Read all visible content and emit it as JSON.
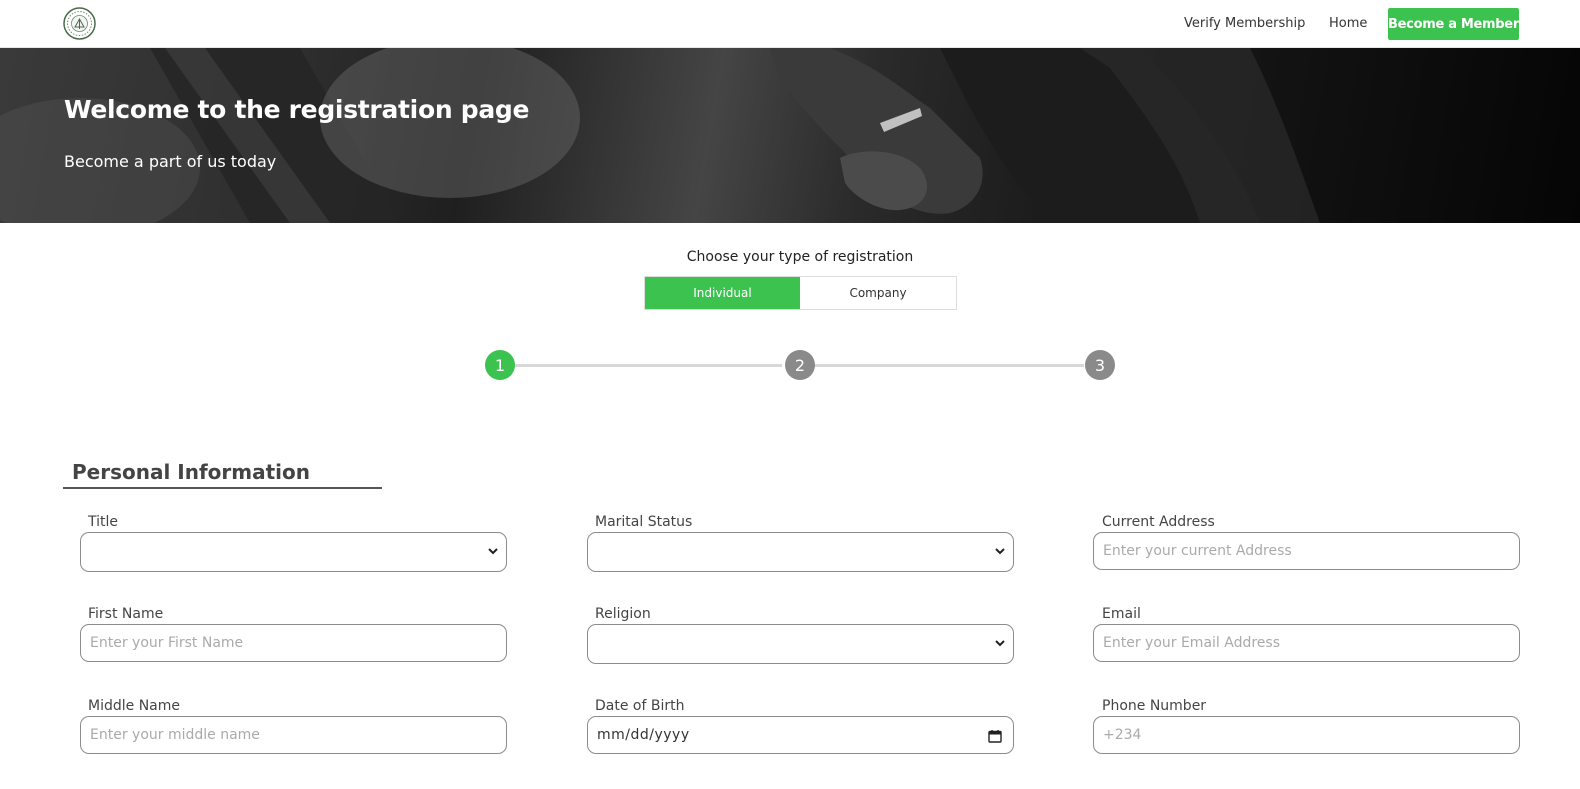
{
  "header": {
    "logo_icon": "seal-logo-icon",
    "nav": {
      "verify_label": "Verify Membership",
      "home_label": "Home",
      "cta_label": "Become a Member"
    },
    "accent_color": "#3cc34f"
  },
  "hero": {
    "title": "Welcome to the registration page",
    "subtitle": "Become a part of us today"
  },
  "registration_type": {
    "prompt": "Choose your type of registration",
    "options": [
      "Individual",
      "Company"
    ],
    "selected": "Individual"
  },
  "stepper": {
    "steps": [
      "1",
      "2",
      "3"
    ],
    "current": "1"
  },
  "form": {
    "section_title": "Personal Information",
    "fields": {
      "title": {
        "label": "Title",
        "value": ""
      },
      "marital_status": {
        "label": "Marital Status",
        "value": ""
      },
      "current_address": {
        "label": "Current Address",
        "placeholder": "Enter your current Address"
      },
      "first_name": {
        "label": "First Name",
        "placeholder": "Enter your First Name"
      },
      "religion": {
        "label": "Religion",
        "value": ""
      },
      "email": {
        "label": "Email",
        "placeholder": "Enter your Email Address"
      },
      "middle_name": {
        "label": "Middle Name",
        "placeholder": "Enter your middle name"
      },
      "date_of_birth": {
        "label": "Date of Birth",
        "value": "mm/dd/yyyy"
      },
      "phone_number": {
        "label": "Phone Number",
        "placeholder": "+234"
      }
    }
  }
}
